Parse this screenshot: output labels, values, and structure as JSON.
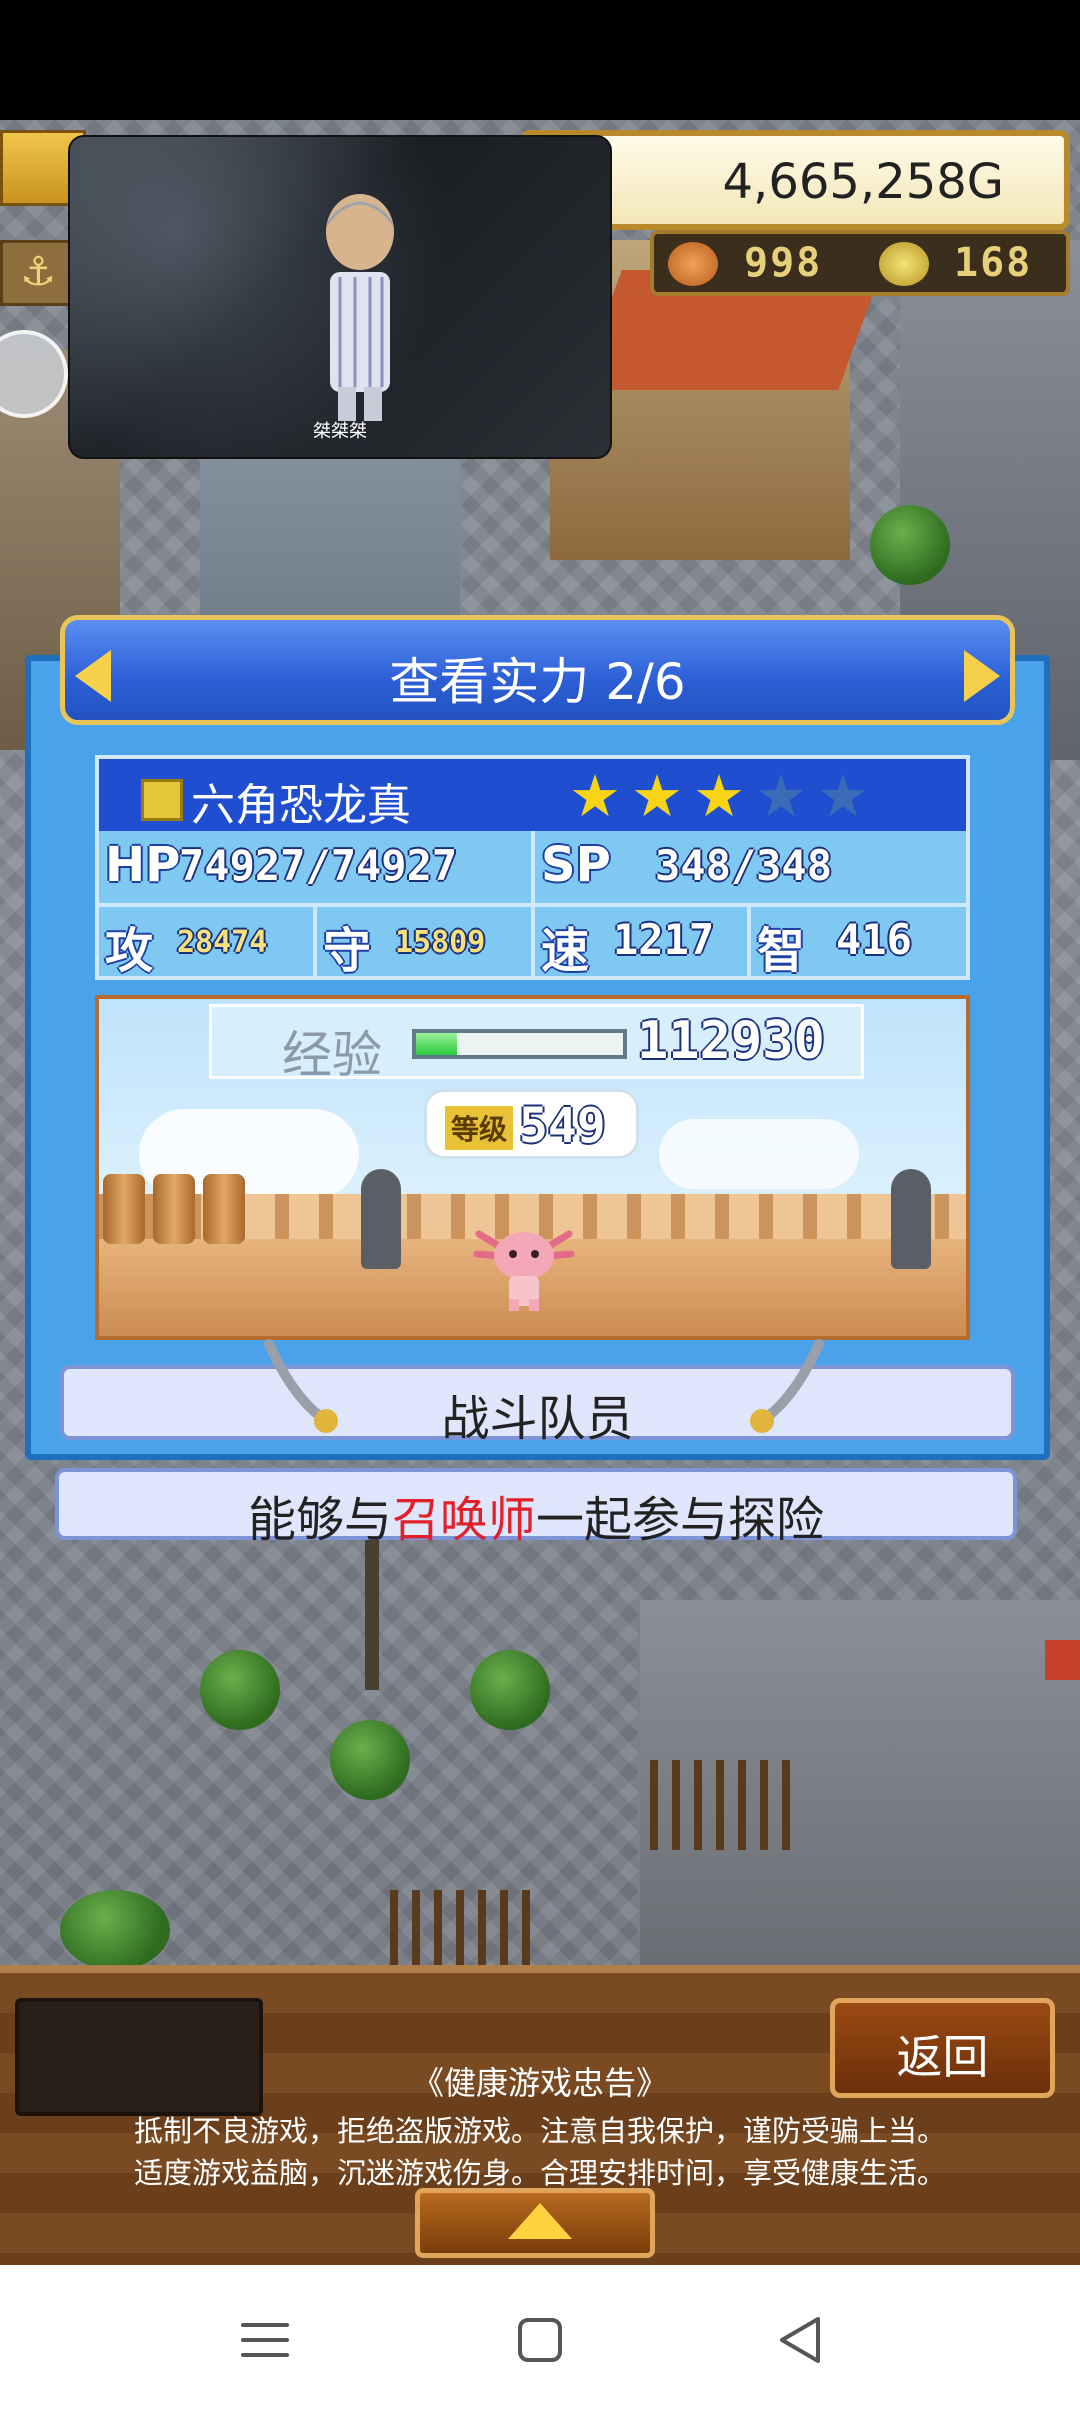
{
  "hud": {
    "gold": "4,665,258G",
    "fish_count": "998",
    "coin_count": "168"
  },
  "video": {
    "caption": "桀桀桀"
  },
  "panel": {
    "title": "查看实力 2/6",
    "monster": {
      "name": "六角恐龙真",
      "stars_filled": 3,
      "stars_total": 5
    },
    "stats": {
      "hp_label": "HP",
      "hp_value": "74927/74927",
      "sp_label": "SP",
      "sp_value": "348/348",
      "atk_label": "攻",
      "atk_value": "28474",
      "def_label": "守",
      "def_value": "15809",
      "spd_label": "速",
      "spd_value": "1217",
      "int_label": "智",
      "int_value": "416"
    },
    "exp": {
      "label": "经验",
      "value": "112930",
      "fill_fraction": 0.2
    },
    "level": {
      "tag": "等级",
      "value": "549"
    },
    "role": "战斗队员",
    "description_pre": "能够与",
    "description_highlight": "召唤师",
    "description_post": "一起参与探险"
  },
  "bottom": {
    "back_label": "返回",
    "notice_title": "《健康游戏忠告》",
    "notice_line1": "抵制不良游戏，拒绝盗版游戏。注意自我保护，谨防受骗上当。",
    "notice_line2": "适度游戏益脑，沉迷游戏伤身。合理安排时间，享受健康生活。"
  },
  "colors": {
    "panel_blue": "#4aa3e8",
    "title_blue": "#2c5fd6",
    "name_row": "#1f4fd0",
    "star_filled": "#f7d416",
    "highlight_red": "#e0202a",
    "exp_green": "#28c93a"
  },
  "icons": {
    "nav_menu": "menu-icon",
    "nav_home": "square-home-icon",
    "nav_back": "triangle-back-icon"
  }
}
